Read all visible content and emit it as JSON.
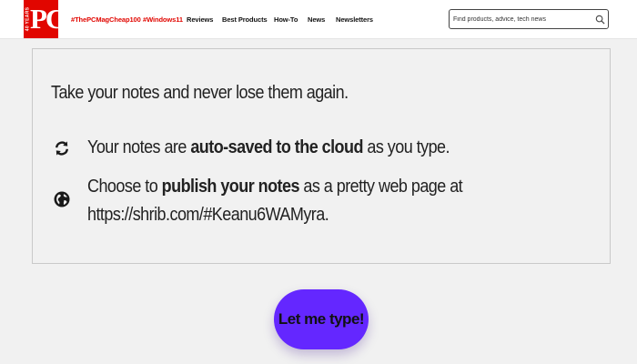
{
  "header": {
    "logo": {
      "badge": "40 YEARS",
      "mark": "PC"
    },
    "nav": [
      {
        "label": "#ThePCMagCheap100",
        "accent": true
      },
      {
        "label": "#Windows11",
        "accent": true
      },
      {
        "label": "Reviews",
        "accent": false
      },
      {
        "label": "Best Products",
        "accent": false
      },
      {
        "label": "How-To",
        "accent": false
      },
      {
        "label": "News",
        "accent": false
      },
      {
        "label": "Newsletters",
        "accent": false
      }
    ],
    "search": {
      "placeholder": "Find products, advice, tech news",
      "icon": "search-icon"
    }
  },
  "card": {
    "intro": "Take your notes and never lose them again.",
    "features": [
      {
        "icon": "sync-icon",
        "before": "Your notes are ",
        "bold": "auto-saved to the cloud",
        "after": " as you type."
      },
      {
        "icon": "globe-icon",
        "before": "Choose to ",
        "bold": "publish your notes",
        "after": " as a pretty web page at",
        "line2": "https://shrib.com/#Keanu6WAMyra."
      }
    ]
  },
  "cta": {
    "label": "Let me type!"
  },
  "colors": {
    "brand": "#e10600",
    "button": "#6427ff",
    "background": "#f1f1f1"
  }
}
